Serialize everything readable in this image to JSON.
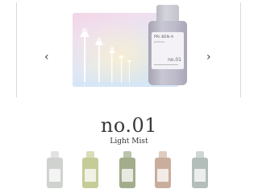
{
  "carousel": {
    "prev_icon": "chevron-left-icon",
    "next_icon": "chevron-right-icon",
    "prev_glyph": "‹",
    "next_glyph": "›"
  },
  "product": {
    "brand": "PRi.BEN-A",
    "sub": "perfume",
    "number_small": "no.01",
    "title": "no.01",
    "name": "Light Mist"
  },
  "colors": {
    "bottle": "#b7b5c3",
    "sky_pink": "#f3d6e6",
    "sky_blue": "#cfe4f8"
  },
  "variants": [
    {
      "id": "v1",
      "cap": "#e2e2e2",
      "body": "#cfd2cf"
    },
    {
      "id": "v2",
      "cap": "#d9ddb8",
      "body": "#c6cc97"
    },
    {
      "id": "v3",
      "cap": "#bcc4aa",
      "body": "#a3ad8c"
    },
    {
      "id": "v4",
      "cap": "#dfccbf",
      "body": "#c9ae9d"
    },
    {
      "id": "v5",
      "cap": "#cfd6d4",
      "body": "#b3bdba"
    }
  ]
}
